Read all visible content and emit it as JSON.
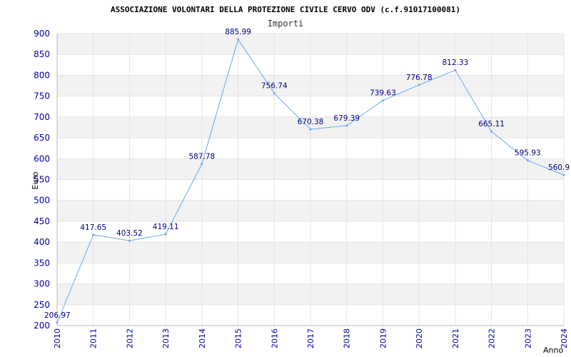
{
  "chart_data": {
    "type": "line",
    "title": "ASSOCIAZIONE VOLONTARI DELLA PROTEZIONE CIVILE CERVO ODV (c.f.91017100081)",
    "subtitle": "Importi",
    "xlabel": "Anno",
    "ylabel": "Euro",
    "x": [
      "2010",
      "2011",
      "2012",
      "2013",
      "2014",
      "2015",
      "2016",
      "2017",
      "2018",
      "2019",
      "2020",
      "2021",
      "2022",
      "2023",
      "2024"
    ],
    "series": [
      {
        "values": [
          206.97,
          417.65,
          403.52,
          419.11,
          587.78,
          885.99,
          756.74,
          670.38,
          679.39,
          739.63,
          776.78,
          812.33,
          665.11,
          595.93,
          560.9
        ],
        "labels": [
          "206.97",
          "417.65",
          "403.52",
          "419.11",
          "587.78",
          "885.99",
          "756.74",
          "670.38",
          "679.39",
          "739.63",
          "776.78",
          "812.33",
          "665.11",
          "595.93",
          "560.9"
        ]
      }
    ],
    "ylim": [
      200,
      900
    ],
    "yticks": [
      "200",
      "250",
      "300",
      "350",
      "400",
      "450",
      "500",
      "550",
      "600",
      "650",
      "700",
      "750",
      "800",
      "850",
      "900"
    ],
    "grid": true,
    "band_color": "#f2f2f2",
    "line_color": "#66aaee",
    "tick_color": "#0000aa",
    "label_color": "#000080"
  }
}
